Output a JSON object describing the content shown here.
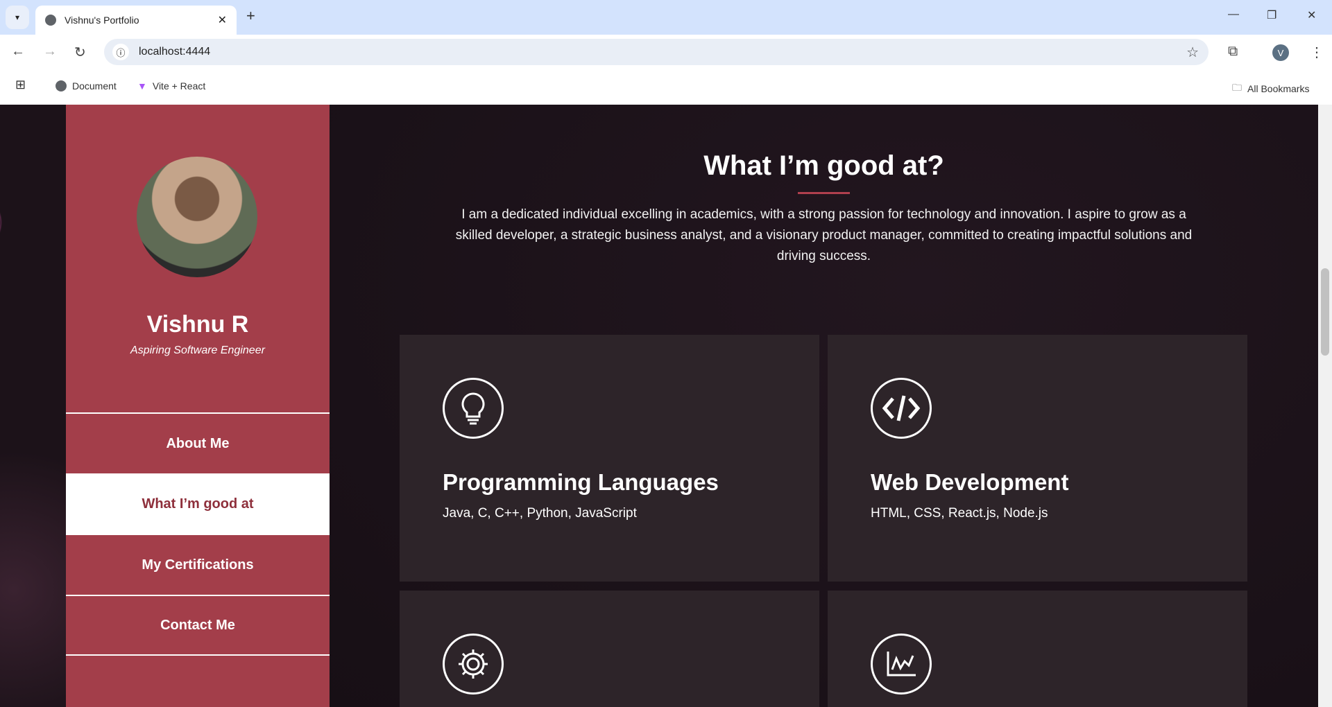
{
  "browser": {
    "tab_title": "Vishnu's Portfolio",
    "url": "localhost:4444",
    "bookmarks": [
      "Document",
      "Vite + React"
    ],
    "all_bookmarks": "All Bookmarks",
    "profile_initial": "V"
  },
  "sidebar": {
    "name": "Vishnu R",
    "role": "Aspiring Software Engineer",
    "nav": [
      {
        "label": "About Me"
      },
      {
        "label": "What I’m good at"
      },
      {
        "label": "My Certifications"
      },
      {
        "label": "Contact Me"
      }
    ]
  },
  "main": {
    "title": "What I’m good at?",
    "description": "I am a dedicated individual excelling in academics, with a strong passion for technology and innovation. I aspire to grow as a skilled developer, a strategic business analyst, and a visionary product manager, committed to creating impactful solutions and driving success.",
    "cards": [
      {
        "icon": "lightbulb-icon",
        "title": "Programming Languages",
        "subtitle": "Java, C, C++, Python, JavaScript"
      },
      {
        "icon": "code-icon",
        "title": "Web Development",
        "subtitle": "HTML, CSS, React.js, Node.js"
      },
      {
        "icon": "gear-icon",
        "title": "",
        "subtitle": ""
      },
      {
        "icon": "chart-icon",
        "title": "",
        "subtitle": ""
      }
    ]
  },
  "colors": {
    "accent": "#a33e4a",
    "background": "#1f151c",
    "card": "#2d2429"
  }
}
